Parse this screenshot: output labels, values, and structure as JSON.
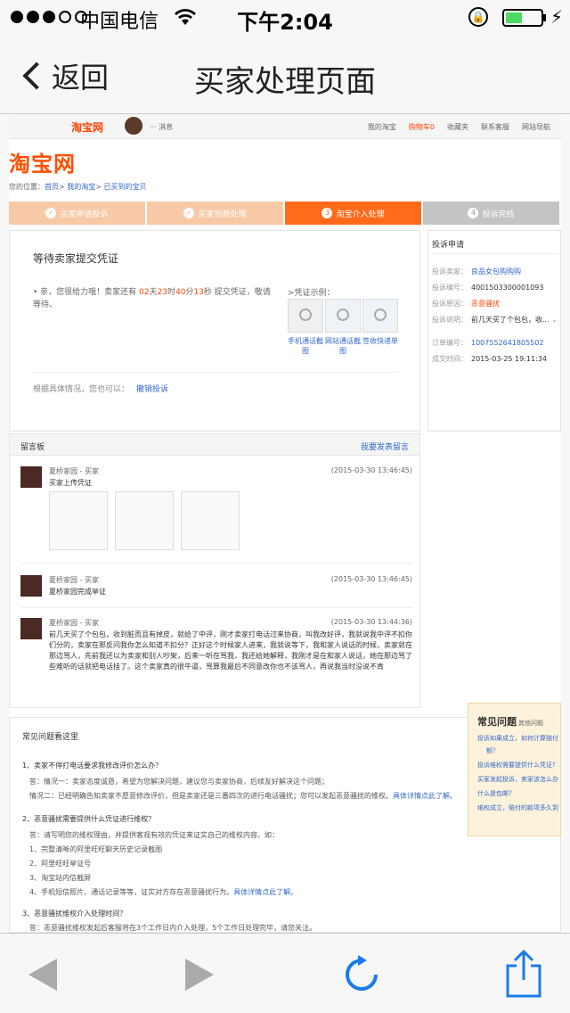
{
  "status_bar": {
    "carrier": "中国电信",
    "time": "下午2:04",
    "battery_level": 0.44
  },
  "nav": {
    "back_label": "返回",
    "title": "买家处理页面"
  },
  "topbar": {
    "logo": "淘宝网",
    "message": "··· 消息",
    "links": [
      "我的淘宝",
      "购物车0",
      "收藏夹",
      "联系客服",
      "网站导航"
    ]
  },
  "brand": "淘宝网",
  "breadcrumb": {
    "prefix": "您的位置：",
    "home": "首页",
    "my": "我的淘宝",
    "bought": "已买到的宝贝"
  },
  "steps": [
    {
      "num": "✓",
      "label": "买家申请投诉"
    },
    {
      "num": "✓",
      "label": "买家协商处理"
    },
    {
      "num": "3",
      "label": "淘宝介入处理"
    },
    {
      "num": "4",
      "label": "投诉完结"
    }
  ],
  "main": {
    "heading": "等待卖家提交凭证",
    "msg_pre": "• 亲，您很给力哦！卖家还有 ",
    "days": "02",
    "days_unit": "天",
    "hours": "23",
    "hours_unit": "时",
    "minutes": "40",
    "minutes_unit": "分",
    "seconds": "13",
    "msg_post": "秒 提交凭证，敬请等待。",
    "example_label": ">凭证示例：",
    "example_caps": [
      "手机通话截图",
      "网站通话截图",
      "签收快递单"
    ],
    "alt_text": "根据具体情况，您也可以：",
    "alt_link": "撤销投诉"
  },
  "side": {
    "title": "投诉申请",
    "rows": [
      {
        "k": "投诉卖家：",
        "v": "良品女包购购购",
        "style": "lk"
      },
      {
        "k": "投诉编号：",
        "v": "4001503300001093",
        "style": "v"
      },
      {
        "k": "投诉原因：",
        "v": "恶意骚扰",
        "style": "red"
      },
      {
        "k": "投诉说明：",
        "v": "前几天买了个包包，收...",
        "style": "v"
      },
      {
        "k": "订单编号：",
        "v": "1007552641805502",
        "style": "lk"
      },
      {
        "k": "成交时间：",
        "v": "2015-03-25 19:11:34",
        "style": "v"
      }
    ]
  },
  "board": {
    "title": "留言板",
    "action": "我要发表留言",
    "entries": [
      {
        "who": "夏桥家园 - 买家",
        "when": "(2015-03-30 13:46:45)",
        "body": "买家上传凭证"
      },
      {
        "who": "夏桥家园 - 买家",
        "when": "(2015-03-30 13:46:45)",
        "body": "夏桥家园完成举证"
      },
      {
        "who": "夏桥家园 - 买家",
        "when": "(2015-03-30 13:44:36)",
        "body": "前几天买了个包包，收到脏而且有掉皮，就给了中评，刚才卖家打电话过来协商，叫我改好评，我就说我中评不扣你们分的，卖家在那反问我你怎么知道不扣分？正好这个时候家人进来，我就说等下，我和家人说话的时候，卖家就在那边骂人，先前我还以为卖家和别人吵架，后来一听在骂我，我还给她解释，我刚才是在和家人说话，她在那边骂了些难听的话就把电话挂了。这个卖家真的很牛逼，骂算我最后不同意改你也不该骂人，再说我当时没说不肯"
      }
    ]
  },
  "faq": {
    "title": "常见问题看这里",
    "lines": [
      {
        "t": "1、卖家不停打电话要求我修改评价怎么办？",
        "c": ""
      },
      {
        "t": "答：情况一：卖家态度诚恳，希望为您解决问题，建议您与卖家协商，后续友好解决这个问题；",
        "c": "ind"
      },
      {
        "t": "情况二：已经明确告知卖家不愿意修改评价，但是卖家还是三番四次的进行电话骚扰；您可以发起恶意骚扰的维权。",
        "c": "ind",
        "link": "具体详情点此了解。"
      },
      {
        "t": "2、恶意骚扰需要提供什么凭证进行维权？",
        "c": ""
      },
      {
        "t": "答：请写明您的维权理由，并提供客观有效的凭证来证实自己的维权内容。如：",
        "c": "ind"
      },
      {
        "t": "1、完整清晰的阿里旺旺聊天历史记录截图",
        "c": "ind"
      },
      {
        "t": "2、阿里旺旺举证号",
        "c": "ind"
      },
      {
        "t": "3、淘宝站内信截屏",
        "c": "ind"
      },
      {
        "t": "4、手机短信照片、通话记录等等，证实对方存在恶意骚扰行为。",
        "c": "ind",
        "link": "具体详情点此了解。"
      },
      {
        "t": "3、恶意骚扰维权介入处理时间？",
        "c": ""
      },
      {
        "t": "答：恶意骚扰维权发起后客服将在3个工作日内介入处理，5个工作日处理完毕，请您关注。",
        "c": "ind"
      }
    ]
  },
  "floater": {
    "title": "常见问题",
    "sub": "其他问题",
    "items": [
      "投诉如果成立，如何计算赔付",
      "额？",
      "投诉维权需要提供什么凭证?",
      "买家发起投诉，卖家该怎么办",
      "什么是包邮？",
      "维权成立，赔付的款项多久到"
    ]
  }
}
